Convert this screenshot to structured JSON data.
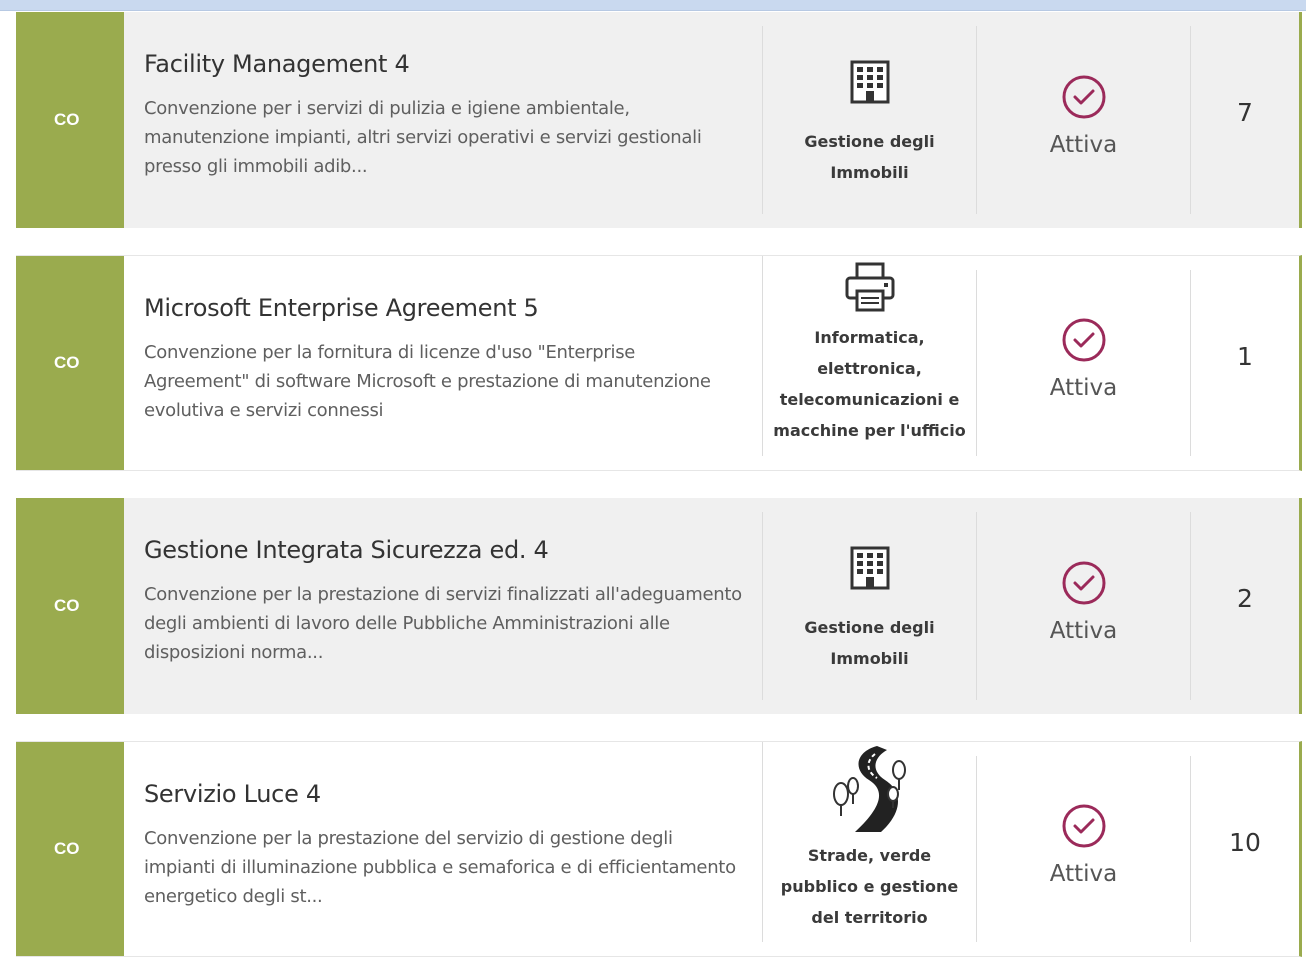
{
  "rows": [
    {
      "code": "CO",
      "title": "Facility Management 4",
      "description": "Convenzione per i servizi di pulizia e igiene ambientale, manutenzione impianti, altri servizi operativi e servizi gestionali presso gli immobili adib...",
      "category": "Gestione degli Immobili",
      "category_icon": "building-icon",
      "status": "Attiva",
      "count": "7"
    },
    {
      "code": "CO",
      "title": "Microsoft Enterprise Agreement 5",
      "description": "Convenzione per la fornitura di licenze d'uso \"Enterprise Agreement\" di software Microsoft e prestazione di manutenzione evolutiva e servizi connessi",
      "category": "Informatica, elettronica, telecomunicazioni e macchine per l'ufficio",
      "category_icon": "printer-icon",
      "status": "Attiva",
      "count": "1"
    },
    {
      "code": "CO",
      "title": "Gestione Integrata Sicurezza ed. 4",
      "description": "Convenzione per la prestazione di servizi finalizzati all'adeguamento degli ambienti di lavoro delle Pubbliche Amministrazioni alle disposizioni norma...",
      "category": "Gestione degli Immobili",
      "category_icon": "building-icon",
      "status": "Attiva",
      "count": "2"
    },
    {
      "code": "CO",
      "title": "Servizio Luce 4",
      "description": "Convenzione per la prestazione del servizio di gestione degli impianti di illuminazione pubblica e semaforica e di efficientamento energetico degli st...",
      "category": "Strade, verde pubblico e gestione del territorio",
      "category_icon": "road-trees-icon",
      "status": "Attiva",
      "count": "10"
    }
  ],
  "colors": {
    "code_bar": "#9aab4e",
    "status_icon": "#9b2a5a"
  }
}
